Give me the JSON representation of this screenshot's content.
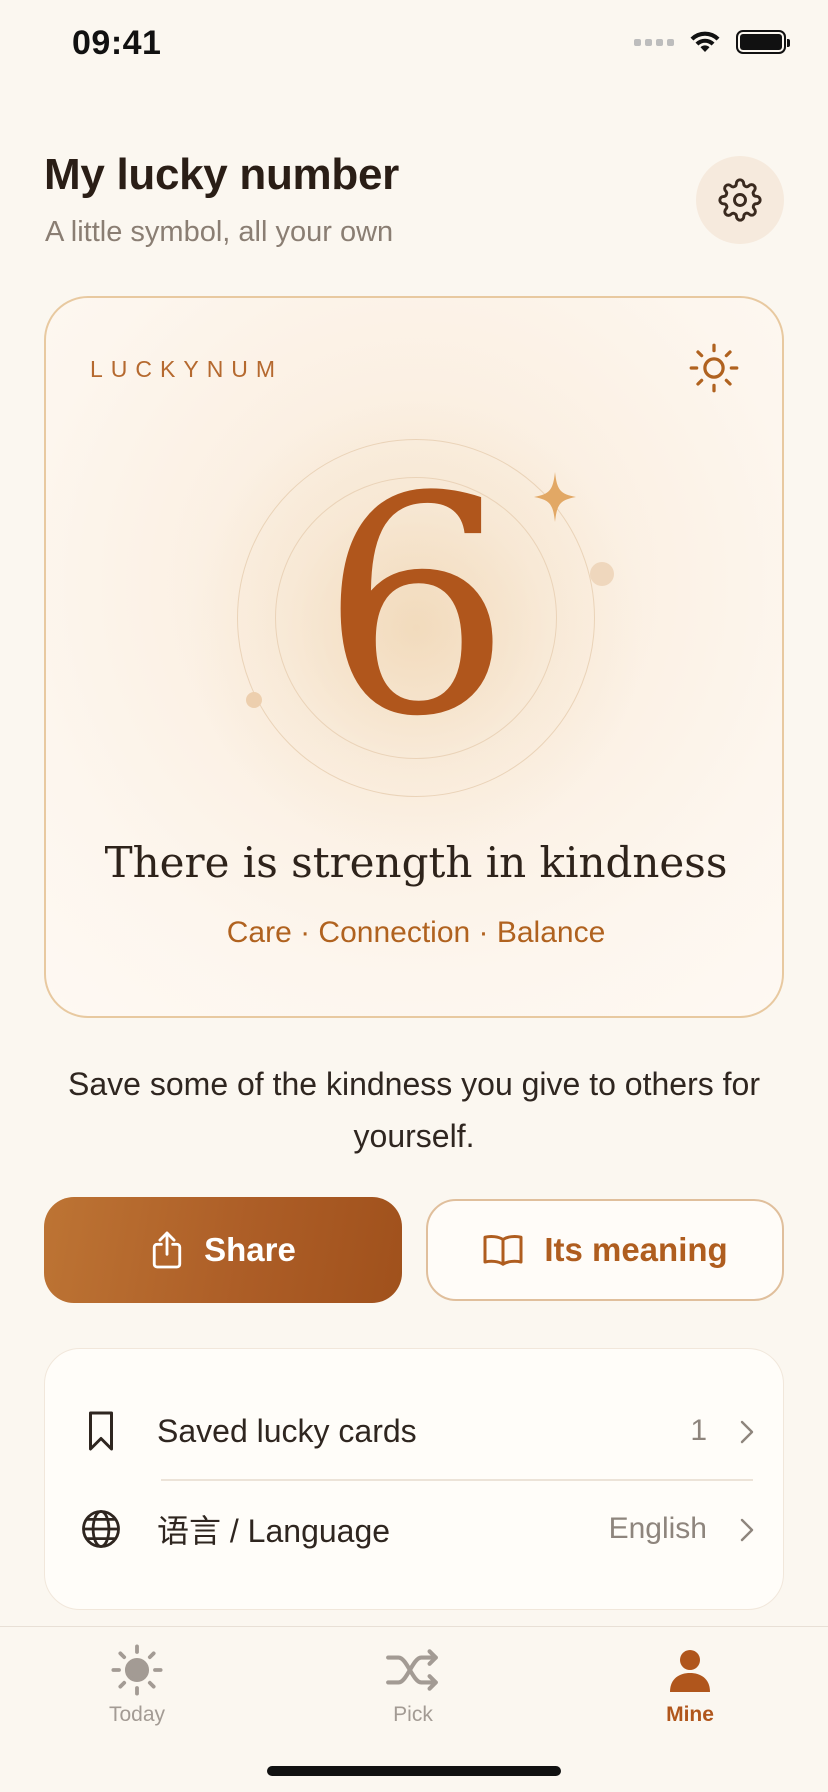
{
  "status_bar": {
    "time": "09:41"
  },
  "header": {
    "title": "My lucky number",
    "subtitle": "A little symbol, all your own"
  },
  "lucky_card": {
    "brand": "LUCKYNUM",
    "number": "6",
    "quote": "There is strength in kindness",
    "tags": "Care · Connection · Balance"
  },
  "message": "Save some of the kindness you give to others for yourself.",
  "actions": {
    "share_label": "Share",
    "meaning_label": "Its meaning"
  },
  "list": {
    "items": [
      {
        "label": "Saved lucky cards",
        "value": "1",
        "icon": "bookmark-icon"
      },
      {
        "label": "语言 / Language",
        "value": "English",
        "icon": "globe-icon"
      }
    ]
  },
  "tabs": [
    {
      "label": "Today",
      "icon": "sun-icon",
      "active": false
    },
    {
      "label": "Pick",
      "icon": "shuffle-icon",
      "active": false
    },
    {
      "label": "Mine",
      "icon": "person-icon",
      "active": true
    }
  ],
  "colors": {
    "accent": "#B0561C",
    "background": "#FBF7F0",
    "card_border": "#E8C9A0",
    "inactive_tab": "#A39B94"
  }
}
